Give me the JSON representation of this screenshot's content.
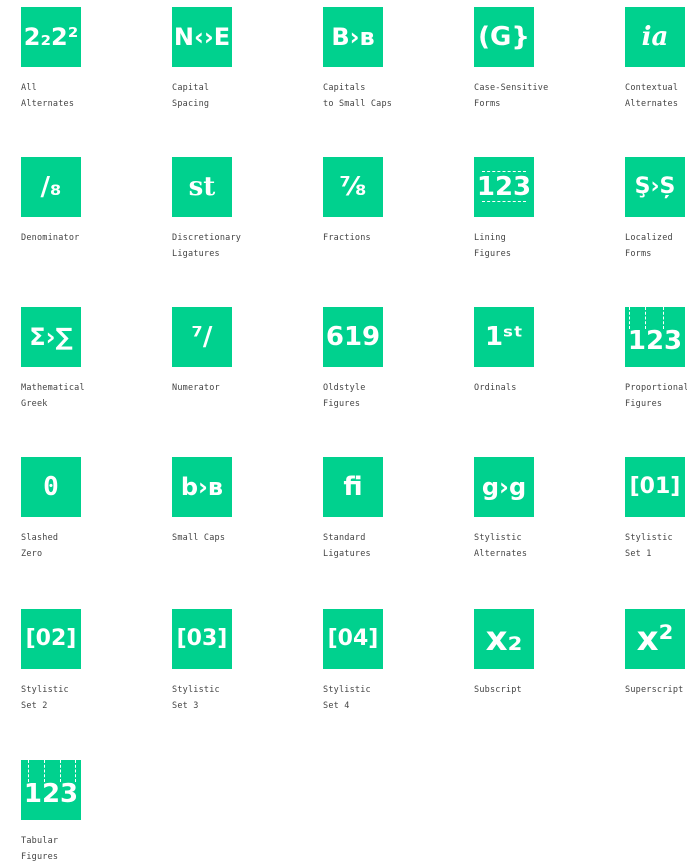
{
  "accent_color": "#00d18e",
  "features": [
    {
      "glyph": "2₂2²",
      "icon": "all-alternates-icon",
      "label": "All\nAlternates"
    },
    {
      "glyph": "N‹›E",
      "icon": "capital-spacing-icon",
      "label": "Capital\nSpacing"
    },
    {
      "glyph": "B›ʙ",
      "icon": "capitals-to-small-caps-icon",
      "label": "Capitals\nto Small Caps"
    },
    {
      "glyph": "(G}",
      "icon": "case-sensitive-forms-icon",
      "label": "Case-Sensitive\nForms"
    },
    {
      "glyph": "ia",
      "icon": "contextual-alternates-icon",
      "label": "Contextual\nAlternates"
    },
    {
      "glyph": "/₈",
      "icon": "denominator-icon",
      "label": "Denominator"
    },
    {
      "glyph": "st",
      "icon": "discretionary-ligatures-icon",
      "label": "Discretionary\nLigatures"
    },
    {
      "glyph": "⁷⁄₈",
      "icon": "fractions-icon",
      "label": "Fractions"
    },
    {
      "glyph": "123",
      "icon": "lining-figures-icon",
      "label": "Lining\nFigures"
    },
    {
      "glyph": "Ş›Ș",
      "icon": "localized-forms-icon",
      "label": "Localized\nForms"
    },
    {
      "glyph": "Σ›∑",
      "icon": "mathematical-greek-icon",
      "label": "Mathematical\nGreek"
    },
    {
      "glyph": "⁷/",
      "icon": "numerator-icon",
      "label": "Numerator"
    },
    {
      "glyph": "619",
      "icon": "oldstyle-figures-icon",
      "label": "Oldstyle\nFigures"
    },
    {
      "glyph": "1ˢᵗ",
      "icon": "ordinals-icon",
      "label": "Ordinals"
    },
    {
      "glyph": "123",
      "icon": "proportional-figures-icon",
      "label": "Proportional\nFigures"
    },
    {
      "glyph": "0",
      "icon": "slashed-zero-icon",
      "label": "Slashed\nZero"
    },
    {
      "glyph": "b›ʙ",
      "icon": "small-caps-icon",
      "label": "Small Caps"
    },
    {
      "glyph": "fi",
      "icon": "standard-ligatures-icon",
      "label": "Standard\nLigatures"
    },
    {
      "glyph": "g›g",
      "icon": "stylistic-alternates-icon",
      "label": "Stylistic\nAlternates"
    },
    {
      "glyph": "[01]",
      "icon": "stylistic-set-1-icon",
      "label": "Stylistic\nSet 1"
    },
    {
      "glyph": "[02]",
      "icon": "stylistic-set-2-icon",
      "label": "Stylistic\nSet 2"
    },
    {
      "glyph": "[03]",
      "icon": "stylistic-set-3-icon",
      "label": "Stylistic\nSet 3"
    },
    {
      "glyph": "[04]",
      "icon": "stylistic-set-4-icon",
      "label": "Stylistic\nSet 4"
    },
    {
      "glyph": "x₂",
      "icon": "subscript-icon",
      "label": "Subscript"
    },
    {
      "glyph": "x²",
      "icon": "superscript-icon",
      "label": "Superscript"
    },
    {
      "glyph": "123",
      "icon": "tabular-figures-icon",
      "label": "Tabular\nFigures"
    }
  ]
}
